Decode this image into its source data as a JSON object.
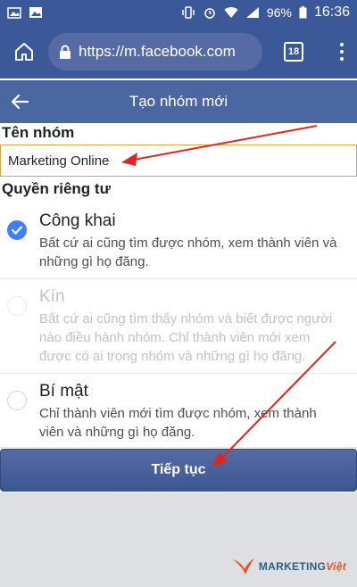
{
  "status_bar": {
    "battery": "96%",
    "time": "16:36"
  },
  "browser": {
    "url": "https://m.facebook.com",
    "tab_count": "18"
  },
  "header": {
    "title": "Tạo nhóm mới"
  },
  "form": {
    "name_label": "Tên nhóm",
    "name_value": "Marketing Online",
    "privacy_label": "Quyền riêng tư",
    "options": [
      {
        "title": "Công khai",
        "desc": "Bất cứ ai cũng tìm được nhóm, xem thành viên và những gì họ đăng.",
        "selected": true
      },
      {
        "title": "Kín",
        "desc": "Bất cứ ai cũng tìm thấy nhóm và biết được người nào điều hành nhóm. Chỉ thành viên mới xem được có ai trong nhóm và những gì họ đăng.",
        "selected": false,
        "disabled": true
      },
      {
        "title": "Bí mật",
        "desc": "Chỉ thành viên mới tìm được nhóm, xem thành viên và những gì họ đăng.",
        "selected": false
      }
    ],
    "continue_label": "Tiếp tục"
  },
  "watermark": {
    "brand_main": "MARKETING",
    "brand_accent": "Việt"
  },
  "colors": {
    "facebook_blue": "#3b5998",
    "header_blue": "#4b67a1",
    "radio_checked": "#4080ff",
    "input_border": "#e0a33a",
    "annotation_red": "#e0261f"
  }
}
